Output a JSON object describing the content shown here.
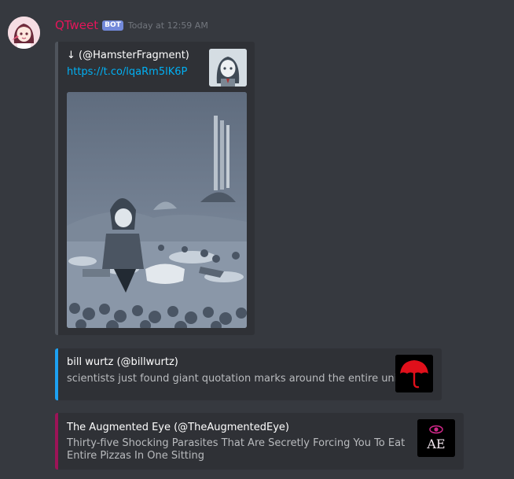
{
  "message": {
    "username": "QTweet",
    "bot_tag": "BOT",
    "timestamp": "Today at 12:59 AM",
    "avatar_icon": "anime-girl-avatar-icon"
  },
  "embeds": [
    {
      "author": "↓ (@HamsterFragment)",
      "link": "https://t.co/lqaRm5lK6P",
      "thumbnail_icon": "anime-girl-thumbnail",
      "image_icon": "anime-illustration-image",
      "border_color": "#4f545c"
    },
    {
      "author": "bill wurtz (@billwurtz)",
      "description": "scientists just found giant quotation marks around the entire universe",
      "thumbnail_icon": "red-umbrella-icon",
      "border_color": "#1da1f2"
    },
    {
      "author": "The Augmented Eye (@TheAugmentedEye)",
      "description": "Thirty-five Shocking Parasites That Are Secretly Forcing You To Eat Entire Pizzas In One Sitting",
      "thumbnail_icon": "ae-logo-icon",
      "thumbnail_text": "AE",
      "border_color": "#9c1457"
    }
  ],
  "colors": {
    "background": "#36393f",
    "embed_background": "#2f3136",
    "username": "#e4155a",
    "link": "#00b0f4",
    "bot_tag": "#7289da"
  }
}
